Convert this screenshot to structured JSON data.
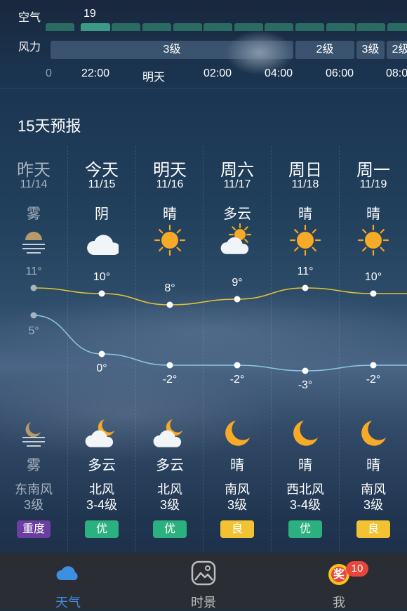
{
  "air": {
    "label": "空气",
    "value": "19"
  },
  "wind_strip": {
    "label": "风力",
    "segments": [
      "3级",
      "2级",
      "3级",
      "2级"
    ]
  },
  "time_axis": [
    "0",
    "22:00",
    "明天",
    "02:00",
    "04:00",
    "06:00",
    "08:0"
  ],
  "forecast": {
    "title": "15天预报",
    "days": [
      {
        "name": "昨天",
        "date": "11/14",
        "day_weather": "雾",
        "day_icon": "fog-sun-icon",
        "high": "11°",
        "low": "5°",
        "night_weather": "雾",
        "night_icon": "fog-moon-icon",
        "wind_dir": "东南风",
        "wind_level": "3级",
        "aqi": "重度",
        "aqi_color": "#6b3fa0"
      },
      {
        "name": "今天",
        "date": "11/15",
        "day_weather": "阴",
        "day_icon": "cloud-icon",
        "high": "10°",
        "low": "0°",
        "night_weather": "多云",
        "night_icon": "cloud-moon-icon",
        "wind_dir": "北风",
        "wind_level": "3-4级",
        "aqi": "优",
        "aqi_color": "#2bb07f"
      },
      {
        "name": "明天",
        "date": "11/16",
        "day_weather": "晴",
        "day_icon": "sun-icon",
        "high": "8°",
        "low": "-2°",
        "night_weather": "多云",
        "night_icon": "cloud-moon-icon",
        "wind_dir": "北风",
        "wind_level": "3级",
        "aqi": "优",
        "aqi_color": "#2bb07f"
      },
      {
        "name": "周六",
        "date": "11/17",
        "day_weather": "多云",
        "day_icon": "sun-cloud-icon",
        "high": "9°",
        "low": "-2°",
        "night_weather": "晴",
        "night_icon": "moon-icon",
        "wind_dir": "南风",
        "wind_level": "3级",
        "aqi": "良",
        "aqi_color": "#f2c233"
      },
      {
        "name": "周日",
        "date": "11/18",
        "day_weather": "晴",
        "day_icon": "sun-icon",
        "high": "11°",
        "low": "-3°",
        "night_weather": "晴",
        "night_icon": "moon-icon",
        "wind_dir": "西北风",
        "wind_level": "3-4级",
        "aqi": "优",
        "aqi_color": "#2bb07f"
      },
      {
        "name": "周一",
        "date": "11/19",
        "day_weather": "晴",
        "day_icon": "sun-icon",
        "high": "10°",
        "low": "-2°",
        "night_weather": "晴",
        "night_icon": "moon-icon",
        "wind_dir": "南风",
        "wind_level": "3级",
        "aqi": "良",
        "aqi_color": "#f2c233"
      }
    ]
  },
  "tabs": [
    {
      "label": "天气",
      "icon": "cloud-tab-icon",
      "active": true
    },
    {
      "label": "时景",
      "icon": "photo-tab-icon",
      "active": false
    },
    {
      "label": "我",
      "icon": "reward-tab-icon",
      "active": false,
      "badge_text": "奖",
      "badge_count": "10"
    }
  ],
  "colors": {
    "high_line": "#e8c530",
    "low_line": "#8fc6e0",
    "active_tab": "#3d8fe0",
    "aqi_bar": "#2a6b63",
    "aqi_bar_active": "#3b9a86"
  }
}
